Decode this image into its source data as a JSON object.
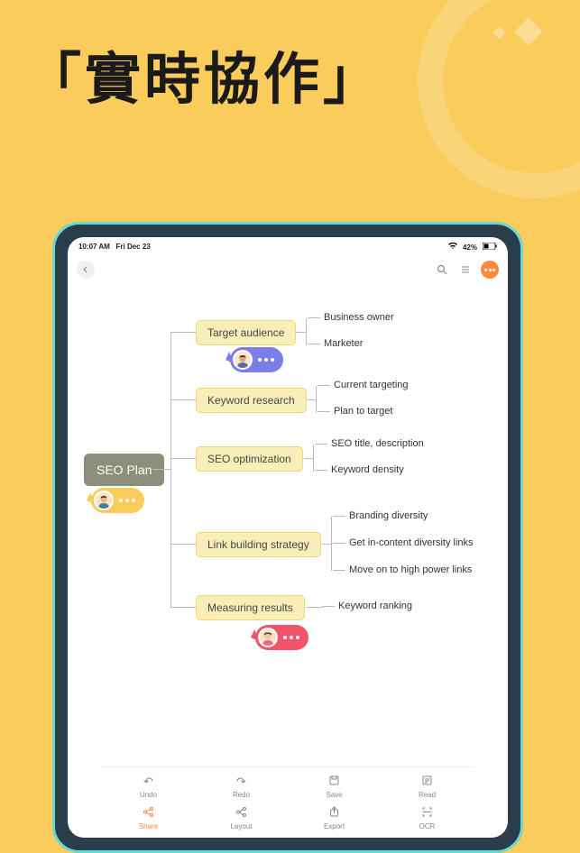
{
  "hero_title": "「實時協作」",
  "statusbar": {
    "time": "10:07 AM",
    "date": "Fri Dec 23",
    "battery": "42%"
  },
  "mindmap": {
    "root": "SEO Plan",
    "branches": [
      {
        "label": "Target audience",
        "children": [
          "Business owner",
          "Marketer"
        ]
      },
      {
        "label": "Keyword research",
        "children": [
          "Current targeting",
          "Plan to target"
        ]
      },
      {
        "label": "SEO optimization",
        "children": [
          "SEO title, description",
          "Keyword density"
        ]
      },
      {
        "label": "Link building strategy",
        "children": [
          "Branding diversity",
          "Get in-content diversity links",
          "Move on to high power links"
        ]
      },
      {
        "label": "Measuring results",
        "children": [
          "Keyword ranking"
        ]
      }
    ]
  },
  "cursors": {
    "blue": "collaborator-1",
    "yellow": "collaborator-2",
    "red": "collaborator-3"
  },
  "toolbar": [
    {
      "label": "Undo",
      "active": false
    },
    {
      "label": "Redo",
      "active": false
    },
    {
      "label": "Save",
      "active": false
    },
    {
      "label": "Read",
      "active": false
    },
    {
      "label": "Share",
      "active": true
    },
    {
      "label": "Layout",
      "active": false
    },
    {
      "label": "Export",
      "active": false
    },
    {
      "label": "OCR",
      "active": false
    }
  ]
}
